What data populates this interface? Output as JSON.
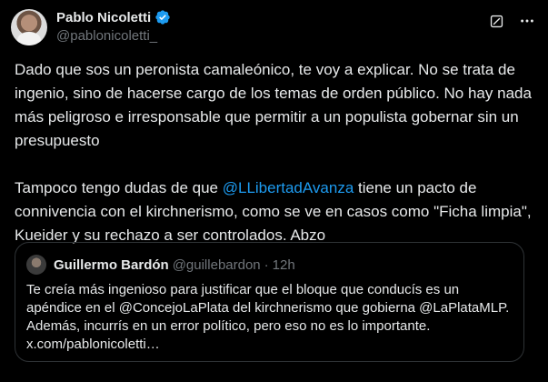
{
  "author": {
    "name": "Pablo Nicoletti",
    "handle": "@pablonicoletti_",
    "verified_icon": "verified-badge-icon"
  },
  "actions": {
    "grok_icon": "grok-icon",
    "more_icon": "more-icon"
  },
  "tweet": {
    "para1": "Dado que sos un peronista camaleónico, te voy a explicar. No se trata de ingenio, sino de hacerse cargo de los temas de orden público. No hay nada más peligroso e irresponsable que permitir a un populista gobernar sin un presupuesto",
    "para2_before": "Tampoco tengo dudas de que ",
    "para2_mention": "@LLibertadAvanza",
    "para2_after": " tiene un pacto de connivencia con el kirchnerismo, como se ve en casos como \"Ficha limpia\", Kueider y su rechazo a ser controlados. Abzo"
  },
  "quote": {
    "name": "Guillermo Bardón",
    "handle": "@guillebardon",
    "dot": "·",
    "time": "12h",
    "lines": [
      "Te creía más ingenioso para justificar que el bloque que conducís es un",
      "apéndice en el @ConcejoLaPlata del kirchnerismo que gobierna @LaPlataMLP.",
      "Además, incurrís en un error político, pero eso no es lo importante.",
      "x.com/pablonicoletti…"
    ]
  },
  "colors": {
    "background": "#000000",
    "text": "#e7e9ea",
    "secondary": "#71767b",
    "link": "#1d9bf0",
    "border": "#2f3336"
  }
}
